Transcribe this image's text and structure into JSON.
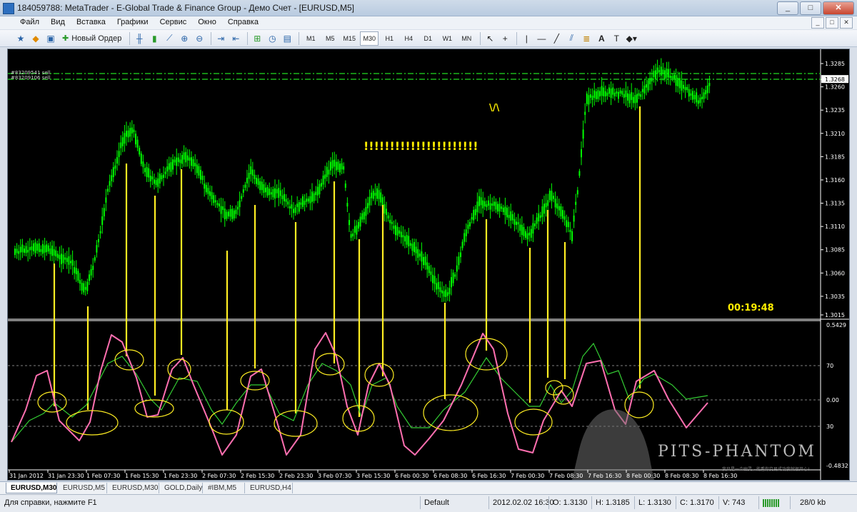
{
  "window": {
    "title": "184059788: MetaTrader - E-Global Trade & Finance Group - Демо Счет - [EURUSD,M5]",
    "buttons": [
      "_",
      "□",
      "✕"
    ]
  },
  "menu": {
    "items": [
      "Файл",
      "Вид",
      "Вставка",
      "Графики",
      "Сервис",
      "Окно",
      "Справка"
    ],
    "mdi_buttons": [
      "_",
      "□",
      "✕"
    ]
  },
  "toolbar": {
    "new_order_label": "Новый Ордер",
    "timeframes": [
      "M1",
      "M5",
      "M15",
      "M30",
      "H1",
      "H4",
      "D1",
      "W1",
      "MN"
    ],
    "text_tool": "A"
  },
  "chart": {
    "symbol": "EURUSD,M5",
    "price_labels": [
      "1.3285",
      "1.3268",
      "1.3260",
      "1.3235",
      "1.3210",
      "1.3185",
      "1.3160",
      "1.3135",
      "1.3110",
      "1.3085",
      "1.3060",
      "1.3035",
      "1.3015"
    ],
    "current_price": "1.3268",
    "order_labels": [
      "#83209541 sell",
      "#83209106 sell"
    ],
    "annotation_exclaim": "!!!!!!!!!!!!!!!!!!!!!!",
    "annotation_v": "\\/\\",
    "timer": "00:19:48",
    "indicator_labels": [
      "0.5429",
      "70",
      "0.00",
      "30",
      "-0.4832"
    ],
    "time_labels": [
      "31 Jan 2012",
      "31 Jan 23:30",
      "1 Feb 07:30",
      "1 Feb 15:30",
      "1 Feb 23:30",
      "2 Feb 07:30",
      "2 Feb 15:30",
      "2 Feb 23:30",
      "3 Feb 07:30",
      "3 Feb 15:30",
      "6 Feb 00:30",
      "6 Feb 08:30",
      "6 Feb 16:30",
      "7 Feb 00:30",
      "7 Feb 08:30",
      "7 Feb 16:30",
      "8 Feb 00:30",
      "8 Feb 08:30",
      "8 Feb 16:30"
    ],
    "watermark": "PITS-PHANTOM",
    "watermark_sub": "我只是一个幽灵，能看你交易成功我就很开心!",
    "colors": {
      "background": "#000000",
      "candles": "#00ff00",
      "vlines": "#ffee22",
      "pink_line": "#ff6fb0",
      "green_line": "#33cc33",
      "order_lines": "#22dd22"
    }
  },
  "tabs": [
    "EURUSD,M30",
    "EURUSD,M5",
    "EURUSD,M30",
    "GOLD,Daily",
    "#IBM,M5",
    "EURUSD,H4"
  ],
  "status": {
    "help": "Для справки, нажмите F1",
    "profile": "Default",
    "datetime": "2012.02.02 16:30",
    "open": "O: 1.3130",
    "high": "H: 1.3185",
    "low": "L: 1.3130",
    "close": "C: 1.3170",
    "volume": "V: 743",
    "traffic": "28/0 kb"
  }
}
